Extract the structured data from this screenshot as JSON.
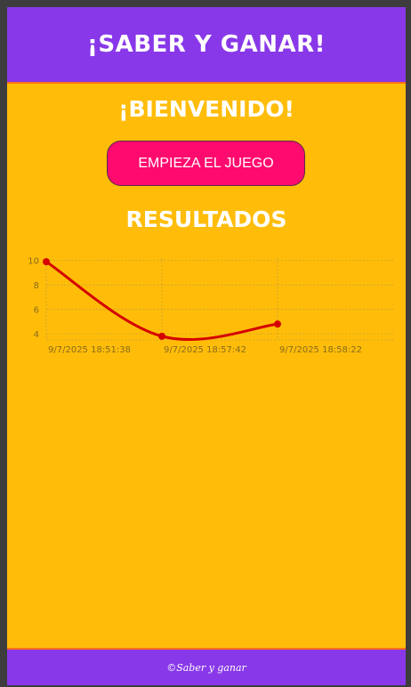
{
  "app": {
    "title": "¡SABER Y GANAR!",
    "welcome": "¡BIENVENIDO!",
    "start_button_label": "EMPIEZA EL JUEGO",
    "results_title": "RESULTADOS",
    "footer": "©Saber y ganar"
  },
  "colors": {
    "header_bg": "#8838e8",
    "page_bg": "#ffbd0a",
    "button_bg": "#ff0a6e",
    "line": "#d40000",
    "grid": "#c9a233",
    "tick_text": "#8a6a1a"
  },
  "chart_data": {
    "type": "line",
    "x": [
      "9/7/2025 18:51:38",
      "9/7/2025 18:57:42",
      "9/7/2025 18:58:22"
    ],
    "series": [
      {
        "values": [
          9.9,
          3.8,
          4.8
        ]
      }
    ],
    "yticks": [
      4,
      6,
      8,
      10
    ],
    "ylim": [
      3.5,
      10.2
    ],
    "grid": true,
    "title": "",
    "xlabel": "",
    "ylabel": ""
  }
}
